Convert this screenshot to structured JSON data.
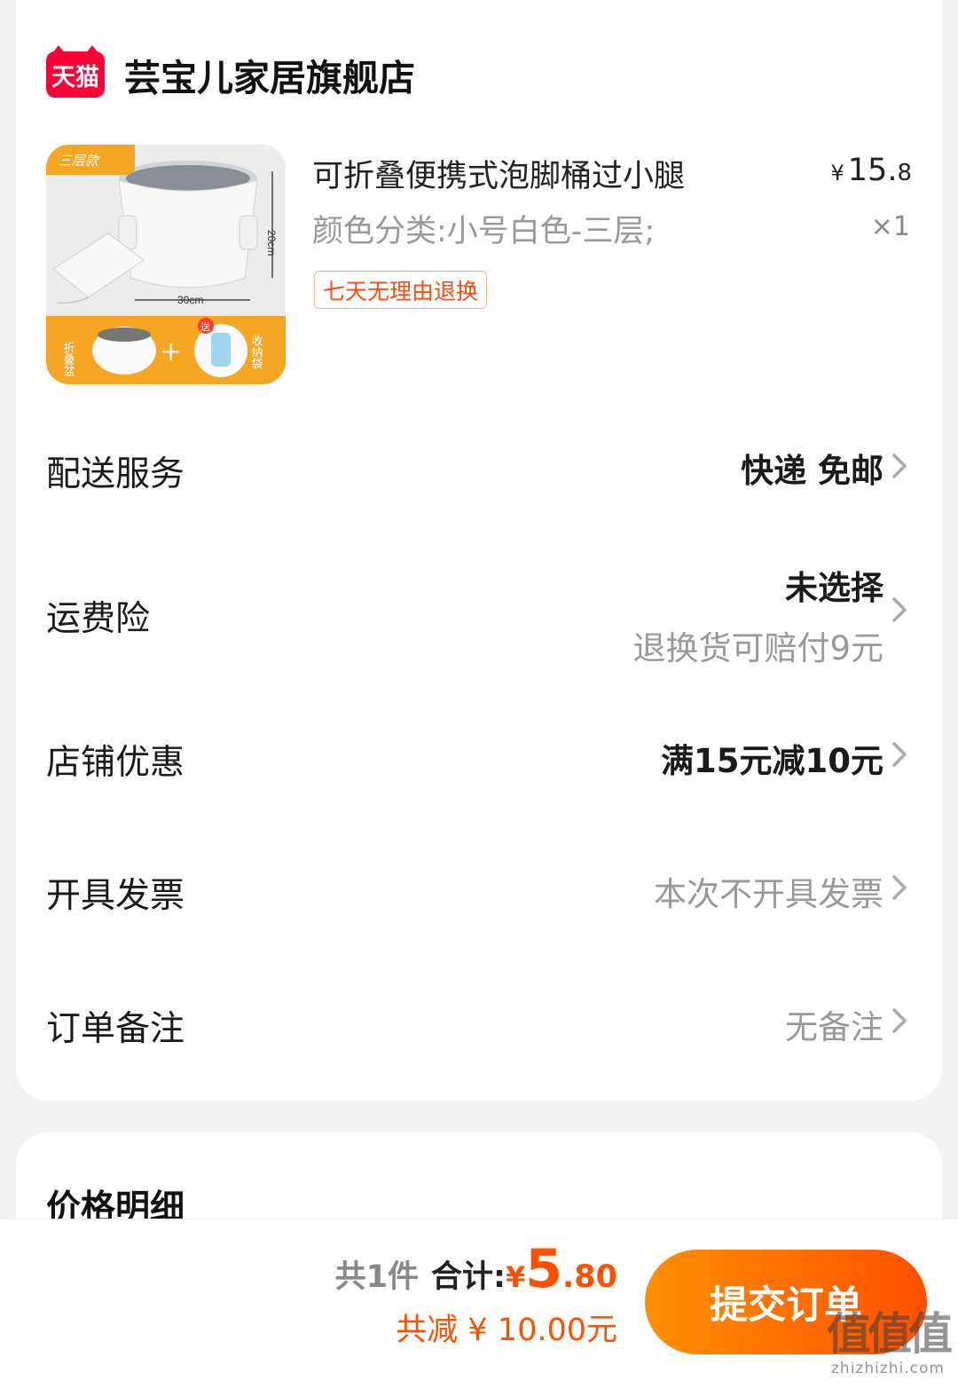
{
  "store": {
    "logo_text": "天猫",
    "name": "芸宝儿家居旗舰店"
  },
  "product": {
    "title": "可折叠便携式泡脚桶过小腿",
    "sku": "颜色分类:小号白色-三层;",
    "price_yen": "¥",
    "price_int": "15.",
    "price_dec": "8",
    "quantity": "×1",
    "return_tag": "七天无理由退换",
    "image": {
      "badge": "三层款",
      "height_label": "20cm",
      "width_label": "30cm",
      "left_caption": "折叠盆",
      "plus": "+",
      "gift_badge": "送",
      "right_caption": "收纳袋"
    }
  },
  "rows": {
    "delivery": {
      "label": "配送服务",
      "value": "快递 免邮"
    },
    "insurance": {
      "label": "运费险",
      "value": "未选择",
      "sub": "退换货可赔付9元"
    },
    "discount": {
      "label": "店铺优惠",
      "value": "满15元减10元"
    },
    "invoice": {
      "label": "开具发票",
      "value": "本次不开具发票"
    },
    "remark": {
      "label": "订单备注",
      "value": "无备注"
    }
  },
  "price_detail": {
    "title": "价格明细"
  },
  "footer": {
    "count": "共1件",
    "total_label": "合计:",
    "total_yen": "¥",
    "total_int": "5",
    "total_dec": ".80",
    "reduce": "共减 ¥ 10.00元",
    "submit": "提交订单"
  },
  "watermark": {
    "big": "值值值",
    "small": "zhizhizhi.com"
  },
  "colors": {
    "accent": "#ff5000",
    "tmall_red": "#ff0036",
    "muted": "#999999"
  }
}
